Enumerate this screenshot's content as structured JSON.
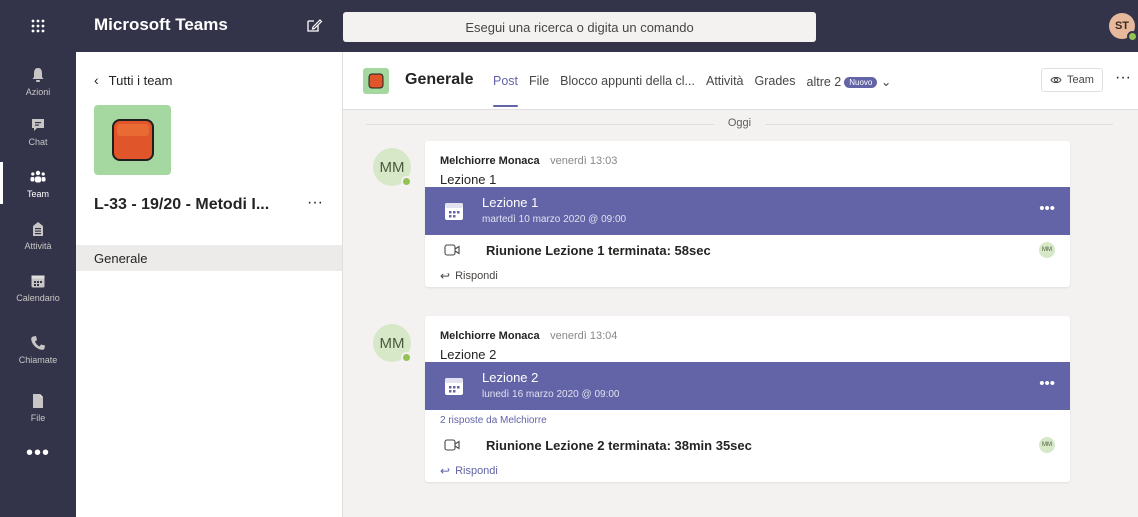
{
  "topbar": {
    "app_title": "Microsoft Teams",
    "search_placeholder": "Esegui una ricerca o digita un comando",
    "user_initials": "ST"
  },
  "rail": {
    "items": [
      {
        "label": "Azioni",
        "icon": "bell-icon"
      },
      {
        "label": "Chat",
        "icon": "chat-icon"
      },
      {
        "label": "Team",
        "icon": "teams-icon"
      },
      {
        "label": "Attività",
        "icon": "assignments-icon"
      },
      {
        "label": "Calendario",
        "icon": "calendar-icon"
      },
      {
        "label": "Chiamate",
        "icon": "phone-icon"
      },
      {
        "label": "File",
        "icon": "file-icon"
      }
    ],
    "active_index": 2,
    "more": "•••"
  },
  "team_panel": {
    "back_label": "Tutti i team",
    "team_name": "L-33 - 19/20 - Metodi I...",
    "more": "···",
    "channels": [
      "Generale"
    ]
  },
  "channel_header": {
    "title": "Generale",
    "tabs": [
      "Post",
      "File",
      "Blocco appunti della cl...",
      "Attività",
      "Grades",
      "altre 2"
    ],
    "active_tab": 0,
    "new_badge": "Nuovo",
    "team_button": "Team",
    "more": "···"
  },
  "feed": {
    "day_label": "Oggi",
    "posts": [
      {
        "avatar": "MM",
        "author": "Melchiorre Monaca",
        "time": "venerdì 13:03",
        "subject": "Lezione 1",
        "meeting_title": "Lezione 1",
        "meeting_date": "martedì 10 marzo 2020 @ 09:00",
        "replies_link": "",
        "ended_text": "Riunione Lezione 1 terminata: 58sec",
        "mini_avatar": "MM",
        "reply_label": "Rispondi"
      },
      {
        "avatar": "MM",
        "author": "Melchiorre Monaca",
        "time": "venerdì 13:04",
        "subject": "Lezione 2",
        "meeting_title": "Lezione 2",
        "meeting_date": "lunedì 16 marzo 2020 @ 09:00",
        "replies_link": "2 risposte da Melchiorre",
        "ended_text": "Riunione Lezione 2 terminata: 38min 35sec",
        "mini_avatar": "MM",
        "reply_label": "Rispondi"
      }
    ]
  },
  "colors": {
    "rail_bg": "#33344a",
    "accent": "#6264a7",
    "presence": "#92c353",
    "team_logo_bg": "#a4d8a0",
    "team_logo_fg": "#e0562a"
  }
}
